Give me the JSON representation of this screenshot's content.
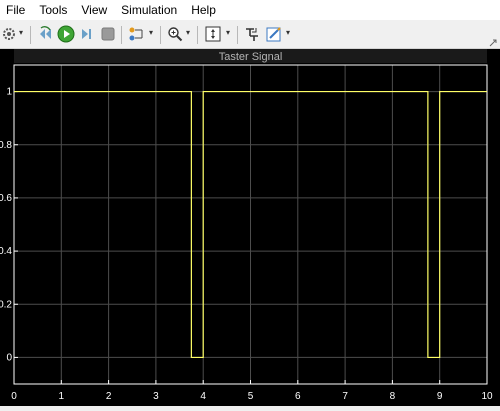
{
  "menu": {
    "items": [
      "File",
      "Tools",
      "View",
      "Simulation",
      "Help"
    ]
  },
  "toolbar": {
    "buttons": [
      {
        "name": "settings-icon"
      },
      {
        "name": "step-back-icon"
      },
      {
        "name": "run-icon"
      },
      {
        "name": "step-forward-icon"
      },
      {
        "name": "stop-icon"
      },
      {
        "name": "highlight-icon"
      },
      {
        "name": "zoom-icon"
      },
      {
        "name": "scale-axes-icon"
      },
      {
        "name": "cursor-measurements-icon"
      },
      {
        "name": "edit-style-icon"
      }
    ]
  },
  "plot": {
    "title": "Taster Signal",
    "colors": {
      "background": "#000000",
      "axes": "#ffffff",
      "grid": "#4d4d4d",
      "signal": "#ffff66",
      "title_bar": "#b4b4b4"
    }
  },
  "chart_data": {
    "type": "line",
    "title": "Taster Signal",
    "xlabel": "",
    "ylabel": "",
    "xlim": [
      0,
      10
    ],
    "ylim": [
      -0.1,
      1.1
    ],
    "xticks": [
      "0",
      "1",
      "2",
      "3",
      "4",
      "5",
      "6",
      "7",
      "8",
      "9",
      "10"
    ],
    "yticks": [
      "0",
      "0.2",
      "0.4",
      "0.6",
      "0.8",
      "1"
    ],
    "ytick_values": [
      0,
      0.2,
      0.4,
      0.6,
      0.8,
      1
    ],
    "xtick_values": [
      0,
      1,
      2,
      3,
      4,
      5,
      6,
      7,
      8,
      9,
      10
    ],
    "grid": true,
    "series": [
      {
        "x": [
          0,
          3.75,
          3.75,
          4.0,
          4.0,
          8.75,
          8.75,
          9.0,
          9.0,
          10
        ],
        "y": [
          1,
          1,
          0,
          0,
          1,
          1,
          0,
          0,
          1,
          1
        ]
      }
    ]
  }
}
